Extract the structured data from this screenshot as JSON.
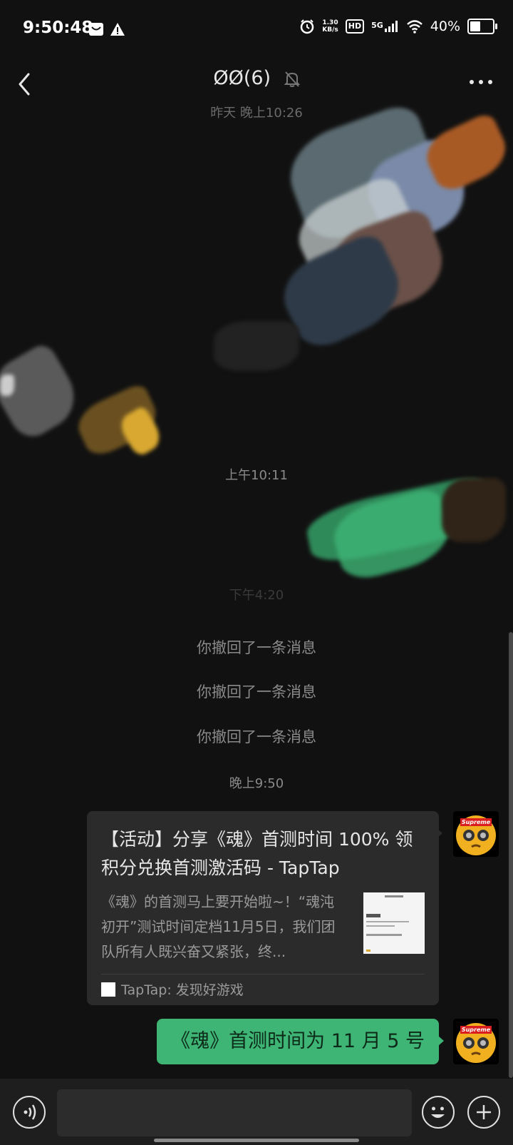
{
  "status_bar": {
    "time": "9:50:48",
    "net_speed_value": "1.30",
    "net_speed_unit": "KB/s",
    "hd_label": "HD",
    "signal_label": "5G",
    "battery": "40%"
  },
  "header": {
    "title": "ØØ(6)",
    "back_icon": "chevron-left-icon",
    "mute_icon": "bell-off-icon",
    "menu_icon": "more-icon"
  },
  "chat": {
    "timestamps": [
      "昨天 晚上10:26",
      "上午10:11",
      "下午4:20",
      "晚上9:50"
    ],
    "recalled": [
      "你撤回了一条消息",
      "你撤回了一条消息",
      "你撤回了一条消息"
    ],
    "link_card": {
      "title": "【活动】分享《魂》首测时间 100% 领积分兑换首测激活码 - TapTap",
      "description": "《魂》的首测马上要开始啦~！“魂沌初开”测试时间定档11月5日，我们团队所有人既兴奋又紧张，终...",
      "source": "TapTap: 发现好游戏"
    },
    "text_message": "《魂》首测时间为 11 月 5 号",
    "avatar_badge": "Supreme"
  },
  "input_bar": {
    "voice_icon": "voice-icon",
    "emoji_icon": "emoji-icon",
    "plus_icon": "plus-icon"
  },
  "colors": {
    "background": "#111111",
    "bubble_green": "#3eb575",
    "card_bg": "#2b2b2b"
  }
}
